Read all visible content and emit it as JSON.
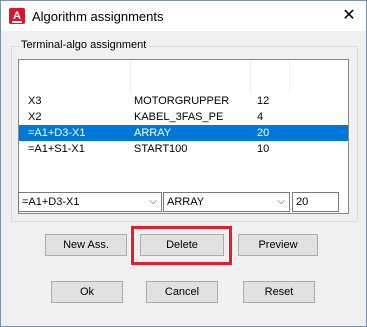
{
  "window": {
    "title": "Algorithm assignments",
    "icon": "autocad-electrical-app-icon",
    "close_glyph": "✕"
  },
  "group": {
    "label": "Terminal-algo assignment"
  },
  "list": {
    "rows": [
      {
        "terminal": "X3",
        "algorithm": "MOTORGRUPPER",
        "value": "12",
        "selected": false
      },
      {
        "terminal": "X2",
        "algorithm": "KABEL_3FAS_PE",
        "value": "4",
        "selected": false
      },
      {
        "terminal": "=A1+D3-X1",
        "algorithm": "ARRAY",
        "value": "20",
        "selected": true
      },
      {
        "terminal": "=A1+S1-X1",
        "algorithm": "START100",
        "value": "10",
        "selected": false
      }
    ],
    "selected_color": "#0078d7"
  },
  "editors": {
    "terminal_combo": "=A1+D3-X1",
    "algorithm_combo": "ARRAY",
    "value_field": "20",
    "arrow_glyph": "⌵"
  },
  "buttons": {
    "new": "New Ass.",
    "delete": "Delete",
    "preview": "Preview",
    "ok": "Ok",
    "cancel": "Cancel",
    "reset": "Reset"
  },
  "annotation": {
    "highlight_color": "#e0202a"
  }
}
